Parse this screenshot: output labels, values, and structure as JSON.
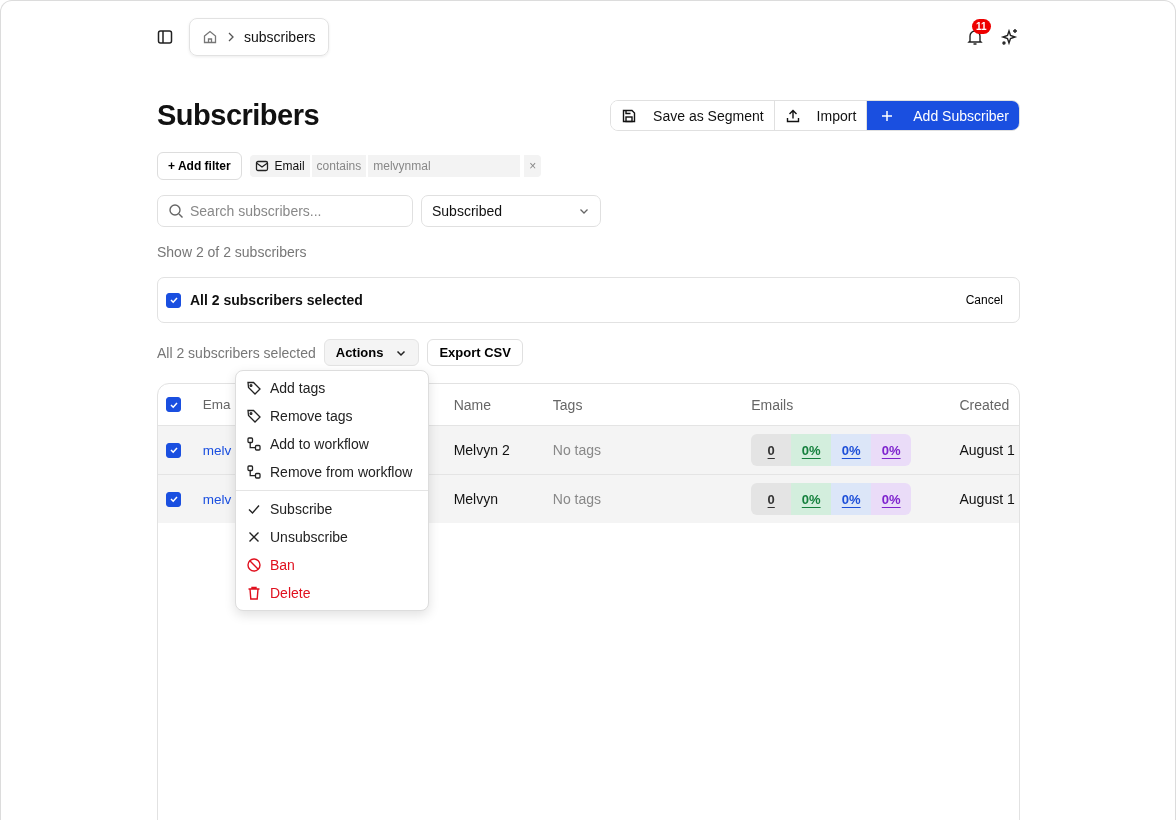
{
  "breadcrumb": {
    "current": "subscribers"
  },
  "notifications": {
    "count": "11"
  },
  "title": "Subscribers",
  "header_buttons": [
    {
      "label": "Save as Segment",
      "kind": "save"
    },
    {
      "label": "Import",
      "kind": "import"
    },
    {
      "label": "Add Subscriber",
      "kind": "primary"
    }
  ],
  "add_filter": "+ Add filter",
  "filter": {
    "field": "Email",
    "operator": "contains",
    "value": "melvynmal",
    "remove": "×"
  },
  "search": {
    "placeholder": "Search subscribers..."
  },
  "status_select": {
    "value": "Subscribed"
  },
  "count_text": "Show 2 of 2 subscribers",
  "selection_bar": {
    "checked": true,
    "text": "All 2 subscribers selected",
    "cancel": "Cancel"
  },
  "bulk": {
    "text": "All 2 subscribers selected",
    "actions": "Actions",
    "export": "Export CSV"
  },
  "table": {
    "header_checked": true,
    "columns": [
      "Ema",
      "Name",
      "Tags",
      "Emails",
      "Created"
    ],
    "rows": [
      {
        "checked": true,
        "email": "melv",
        "name": "Melvyn 2",
        "tags": "No tags",
        "stats": [
          {
            "value": "0",
            "color": "#333333"
          },
          {
            "value": "0%",
            "color": "#15803d"
          },
          {
            "value": "0%",
            "color": "#1d4ed8"
          },
          {
            "value": "0%",
            "color": "#7e22ce"
          }
        ],
        "created": "August 1"
      },
      {
        "checked": true,
        "email": "melv",
        "name": "Melvyn",
        "tags": "No tags",
        "stats": [
          {
            "value": "0",
            "color": "#333333"
          },
          {
            "value": "0%",
            "color": "#15803d"
          },
          {
            "value": "0%",
            "color": "#1d4ed8"
          },
          {
            "value": "0%",
            "color": "#7e22ce"
          }
        ],
        "created": "August 1"
      }
    ]
  },
  "actions_menu": {
    "groups": [
      [
        {
          "label": "Add tags",
          "danger": false
        },
        {
          "label": "Remove tags",
          "danger": false
        },
        {
          "label": "Add to workflow",
          "danger": false
        },
        {
          "label": "Remove from workflow",
          "danger": false
        }
      ],
      [
        {
          "label": "Subscribe",
          "danger": false
        },
        {
          "label": "Unsubscribe",
          "danger": false
        },
        {
          "label": "Ban",
          "danger": true
        },
        {
          "label": "Delete",
          "danger": true
        }
      ]
    ]
  }
}
